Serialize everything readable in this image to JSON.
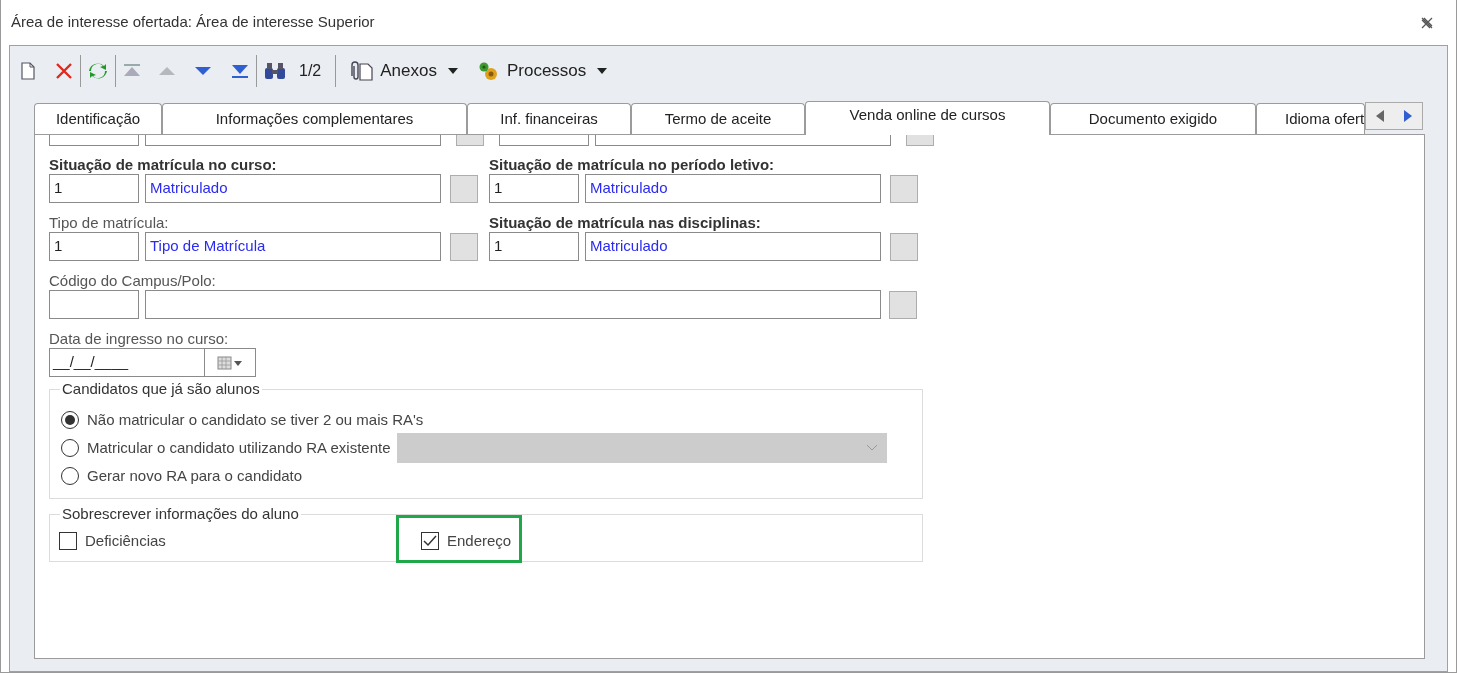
{
  "window": {
    "title": "Área de interesse ofertada: Área de interesse Superior"
  },
  "toolbar": {
    "page_counter": "1/2",
    "menus": [
      {
        "kind": "attachments",
        "label": "Anexos"
      },
      {
        "kind": "processes",
        "label": "Processos"
      }
    ]
  },
  "tabs": [
    {
      "label": "Identificação",
      "selected": false
    },
    {
      "label": "Informações complementares",
      "selected": false
    },
    {
      "label": "Inf. financeiras",
      "selected": false
    },
    {
      "label": "Termo de aceite",
      "selected": false
    },
    {
      "label": "Venda online de cursos",
      "selected": true
    },
    {
      "label": "Documento exigido",
      "selected": false
    },
    {
      "label": "Idioma ofert",
      "selected": false
    }
  ],
  "form": {
    "rows": [
      [
        {
          "kind": "lookup",
          "label": "Situação de matrícula no curso:",
          "bold": true,
          "code": "1",
          "description": "Matriculado"
        },
        {
          "kind": "lookup",
          "label": "Situação de matrícula no período letivo:",
          "bold": true,
          "code": "1",
          "description": "Matriculado"
        }
      ],
      [
        {
          "kind": "lookup",
          "label": "Tipo de matrícula:",
          "bold": false,
          "code": "1",
          "description": "Tipo de Matrícula"
        },
        {
          "kind": "lookup",
          "label": "Situação de matrícula nas disciplinas:",
          "bold": true,
          "code": "1",
          "description": "Matriculado"
        }
      ],
      [
        {
          "kind": "lookup_wide",
          "label": "Código do Campus/Polo:",
          "bold": false
        }
      ],
      [
        {
          "kind": "date",
          "label": "Data de ingresso no curso:",
          "value": "__/__/____"
        }
      ]
    ]
  },
  "groups": [
    {
      "kind": "radios",
      "title": "Candidatos que já são alunos",
      "options": [
        {
          "label": "Não matricular o candidato se tiver 2 ou mais RA's",
          "selected": true
        },
        {
          "label": "Matricular o candidato utilizando RA existente",
          "selected": false,
          "dropdown": {
            "disabled": true
          }
        },
        {
          "label": "Gerar novo RA para o candidato",
          "selected": false
        }
      ]
    },
    {
      "kind": "checkboxes",
      "title": "Sobrescrever informações do aluno",
      "options": [
        {
          "label": "Deficiências",
          "checked": false,
          "highlighted": false
        },
        {
          "label": "Endereço",
          "checked": true,
          "highlighted": true
        }
      ]
    }
  ]
}
